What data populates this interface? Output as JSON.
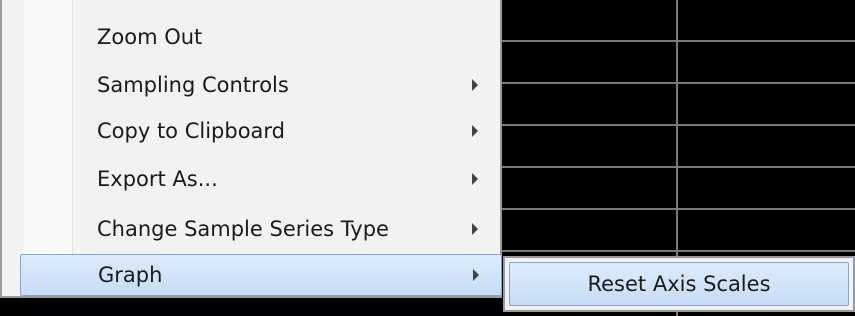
{
  "context_menu": {
    "items": [
      {
        "label": "Zoom Out",
        "has_submenu": false
      },
      {
        "label": "Sampling Controls",
        "has_submenu": true
      },
      {
        "label": "Copy to Clipboard",
        "has_submenu": true
      },
      {
        "label": "Export As...",
        "has_submenu": true
      },
      {
        "label": "Change Sample Series Type",
        "has_submenu": true
      },
      {
        "label": "Graph",
        "has_submenu": true,
        "highlighted": true
      }
    ]
  },
  "graph_submenu": {
    "items": [
      {
        "label": "Reset Axis Scales",
        "highlighted": true
      }
    ]
  },
  "colors": {
    "chart_background": "#000000",
    "grid_line": "#7a7a7a",
    "menu_background": "#f2f2f2",
    "highlight": "#c6dcf6",
    "highlight_border": "#7fa8d8"
  }
}
